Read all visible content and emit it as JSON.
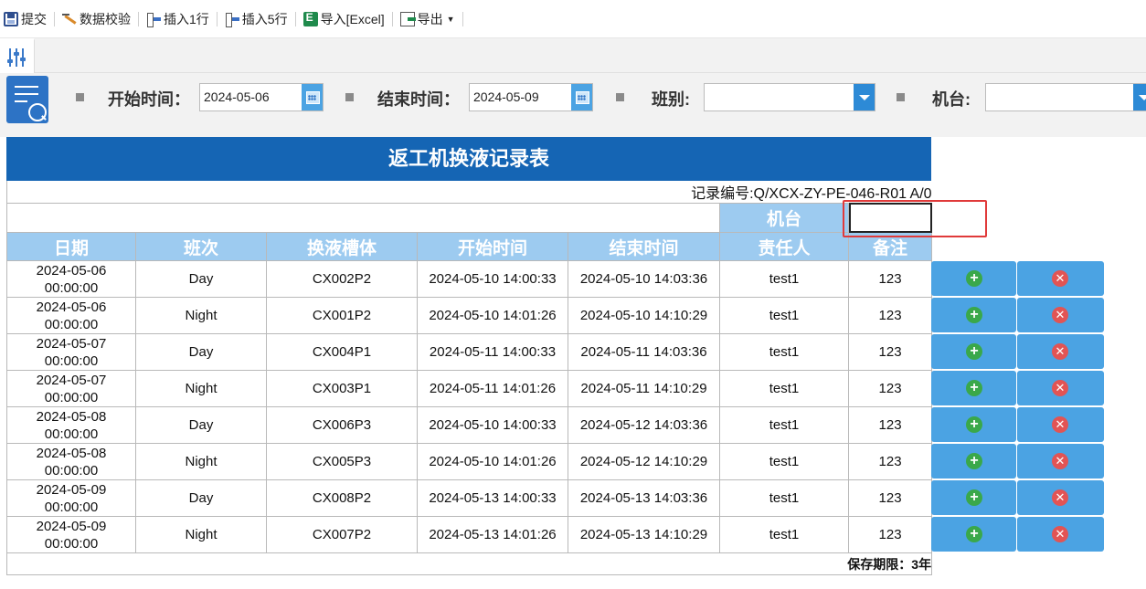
{
  "toolbar": {
    "items": [
      {
        "label": "提交",
        "icon": "save-icon"
      },
      {
        "label": "数据校验",
        "icon": "pen-icon"
      },
      {
        "label": "插入1行",
        "icon": "insert-row-icon"
      },
      {
        "label": "插入5行",
        "icon": "insert-rows-icon"
      },
      {
        "label": "导入[Excel]",
        "icon": "excel-icon"
      },
      {
        "label": "导出",
        "icon": "export-icon"
      }
    ]
  },
  "filters": {
    "start_label": "开始时间：",
    "start_value": "2024-05-06",
    "end_label": "结束时间：",
    "end_value": "2024-05-09",
    "shift_label": "班别:",
    "shift_value": "",
    "machine_label": "机台:",
    "machine_value": ""
  },
  "report": {
    "title": "返工机换液记录表",
    "record_no": "记录编号:Q/XCX-ZY-PE-046-R01 A/0",
    "machine_label": "机台",
    "machine_value": "",
    "columns": [
      "日期",
      "班次",
      "换液槽体",
      "开始时间",
      "结束时间",
      "责任人",
      "备注"
    ],
    "rows": [
      {
        "date": "2024-05-06",
        "time": "00:00:00",
        "shift": "Day",
        "tank": "CX002P2",
        "start": "2024-05-10 14:00:33",
        "end": "2024-05-10 14:03:36",
        "owner": "test1",
        "note": "123"
      },
      {
        "date": "2024-05-06",
        "time": "00:00:00",
        "shift": "Night",
        "tank": "CX001P2",
        "start": "2024-05-10 14:01:26",
        "end": "2024-05-10 14:10:29",
        "owner": "test1",
        "note": "123"
      },
      {
        "date": "2024-05-07",
        "time": "00:00:00",
        "shift": "Day",
        "tank": "CX004P1",
        "start": "2024-05-11 14:00:33",
        "end": "2024-05-11 14:03:36",
        "owner": "test1",
        "note": "123"
      },
      {
        "date": "2024-05-07",
        "time": "00:00:00",
        "shift": "Night",
        "tank": "CX003P1",
        "start": "2024-05-11 14:01:26",
        "end": "2024-05-11 14:10:29",
        "owner": "test1",
        "note": "123"
      },
      {
        "date": "2024-05-08",
        "time": "00:00:00",
        "shift": "Day",
        "tank": "CX006P3",
        "start": "2024-05-10 14:00:33",
        "end": "2024-05-12 14:03:36",
        "owner": "test1",
        "note": "123"
      },
      {
        "date": "2024-05-08",
        "time": "00:00:00",
        "shift": "Night",
        "tank": "CX005P3",
        "start": "2024-05-10 14:01:26",
        "end": "2024-05-12 14:10:29",
        "owner": "test1",
        "note": "123"
      },
      {
        "date": "2024-05-09",
        "time": "00:00:00",
        "shift": "Day",
        "tank": "CX008P2",
        "start": "2024-05-13 14:00:33",
        "end": "2024-05-13 14:03:36",
        "owner": "test1",
        "note": "123"
      },
      {
        "date": "2024-05-09",
        "time": "00:00:00",
        "shift": "Night",
        "tank": "CX007P2",
        "start": "2024-05-13 14:01:26",
        "end": "2024-05-13 14:10:29",
        "owner": "test1",
        "note": "123"
      }
    ],
    "footer": "保存期限：3年"
  },
  "colors": {
    "title_bg": "#1565b4",
    "header_bg": "#9dcbf0",
    "action_bg": "#4ba3e3",
    "add_green": "#3aa84a",
    "delete_red": "#e25454",
    "highlight_box": "#e03a3a"
  }
}
